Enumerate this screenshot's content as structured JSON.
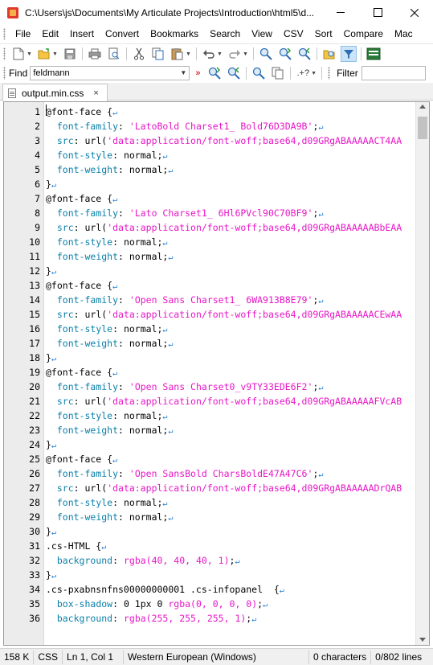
{
  "window": {
    "title": "C:\\Users\\js\\Documents\\My Articulate Projects\\Introduction\\html5\\d..."
  },
  "menu": [
    "File",
    "Edit",
    "Insert",
    "Convert",
    "Bookmarks",
    "Search",
    "View",
    "CSV",
    "Sort",
    "Compare",
    "Mac"
  ],
  "findbar": {
    "label": "Find",
    "value": "feldmann",
    "regex_label": ".+?",
    "filter_label": "Filter",
    "filter_value": ""
  },
  "tab": {
    "label": "output.min.css",
    "close": "×"
  },
  "editor": {
    "lines": [
      {
        "n": "1",
        "parts": [
          [
            "n",
            "@font-face {"
          ]
        ]
      },
      {
        "n": "2",
        "parts": [
          [
            "n",
            "  "
          ],
          [
            "k",
            "font-family"
          ],
          [
            "n",
            ": "
          ],
          [
            "s",
            "'LatoBold Charset1_ Bold76D3DA9B'"
          ],
          [
            "n",
            ";"
          ]
        ]
      },
      {
        "n": "3",
        "parts": [
          [
            "n",
            "  "
          ],
          [
            "k",
            "src"
          ],
          [
            "n",
            ": url("
          ],
          [
            "s",
            "'data:application/font-woff;base64,d09GRgABAAAAACT4AA"
          ]
        ]
      },
      {
        "n": "4",
        "parts": [
          [
            "n",
            "  "
          ],
          [
            "k",
            "font-style"
          ],
          [
            "n",
            ": normal;"
          ]
        ]
      },
      {
        "n": "5",
        "parts": [
          [
            "n",
            "  "
          ],
          [
            "k",
            "font-weight"
          ],
          [
            "n",
            ": normal;"
          ]
        ]
      },
      {
        "n": "6",
        "parts": [
          [
            "n",
            "}"
          ]
        ]
      },
      {
        "n": "7",
        "parts": [
          [
            "n",
            "@font-face {"
          ]
        ]
      },
      {
        "n": "8",
        "parts": [
          [
            "n",
            "  "
          ],
          [
            "k",
            "font-family"
          ],
          [
            "n",
            ": "
          ],
          [
            "s",
            "'Lato Charset1_ 6Hl6PVcl90C70BF9'"
          ],
          [
            "n",
            ";"
          ]
        ]
      },
      {
        "n": "9",
        "parts": [
          [
            "n",
            "  "
          ],
          [
            "k",
            "src"
          ],
          [
            "n",
            ": url("
          ],
          [
            "s",
            "'data:application/font-woff;base64,d09GRgABAAAAABbEAA"
          ]
        ]
      },
      {
        "n": "10",
        "parts": [
          [
            "n",
            "  "
          ],
          [
            "k",
            "font-style"
          ],
          [
            "n",
            ": normal;"
          ]
        ]
      },
      {
        "n": "11",
        "parts": [
          [
            "n",
            "  "
          ],
          [
            "k",
            "font-weight"
          ],
          [
            "n",
            ": normal;"
          ]
        ]
      },
      {
        "n": "12",
        "parts": [
          [
            "n",
            "}"
          ]
        ]
      },
      {
        "n": "13",
        "parts": [
          [
            "n",
            "@font-face {"
          ]
        ]
      },
      {
        "n": "14",
        "parts": [
          [
            "n",
            "  "
          ],
          [
            "k",
            "font-family"
          ],
          [
            "n",
            ": "
          ],
          [
            "s",
            "'Open Sans Charset1_ 6WA913B8E79'"
          ],
          [
            "n",
            ";"
          ]
        ]
      },
      {
        "n": "15",
        "parts": [
          [
            "n",
            "  "
          ],
          [
            "k",
            "src"
          ],
          [
            "n",
            ": url("
          ],
          [
            "s",
            "'data:application/font-woff;base64,d09GRgABAAAAACEwAA"
          ]
        ]
      },
      {
        "n": "16",
        "parts": [
          [
            "n",
            "  "
          ],
          [
            "k",
            "font-style"
          ],
          [
            "n",
            ": normal;"
          ]
        ]
      },
      {
        "n": "17",
        "parts": [
          [
            "n",
            "  "
          ],
          [
            "k",
            "font-weight"
          ],
          [
            "n",
            ": normal;"
          ]
        ]
      },
      {
        "n": "18",
        "parts": [
          [
            "n",
            "}"
          ]
        ]
      },
      {
        "n": "19",
        "parts": [
          [
            "n",
            "@font-face {"
          ]
        ]
      },
      {
        "n": "20",
        "parts": [
          [
            "n",
            "  "
          ],
          [
            "k",
            "font-family"
          ],
          [
            "n",
            ": "
          ],
          [
            "s",
            "'Open Sans Charset0_v9TY33EDE6F2'"
          ],
          [
            "n",
            ";"
          ]
        ]
      },
      {
        "n": "21",
        "parts": [
          [
            "n",
            "  "
          ],
          [
            "k",
            "src"
          ],
          [
            "n",
            ": url("
          ],
          [
            "s",
            "'data:application/font-woff;base64,d09GRgABAAAAAFVcAB"
          ]
        ]
      },
      {
        "n": "22",
        "parts": [
          [
            "n",
            "  "
          ],
          [
            "k",
            "font-style"
          ],
          [
            "n",
            ": normal;"
          ]
        ]
      },
      {
        "n": "23",
        "parts": [
          [
            "n",
            "  "
          ],
          [
            "k",
            "font-weight"
          ],
          [
            "n",
            ": normal;"
          ]
        ]
      },
      {
        "n": "24",
        "parts": [
          [
            "n",
            "}"
          ]
        ]
      },
      {
        "n": "25",
        "parts": [
          [
            "n",
            "@font-face {"
          ]
        ]
      },
      {
        "n": "26",
        "parts": [
          [
            "n",
            "  "
          ],
          [
            "k",
            "font-family"
          ],
          [
            "n",
            ": "
          ],
          [
            "s",
            "'Open SansBold CharsBoldE47A47C6'"
          ],
          [
            "n",
            ";"
          ]
        ]
      },
      {
        "n": "27",
        "parts": [
          [
            "n",
            "  "
          ],
          [
            "k",
            "src"
          ],
          [
            "n",
            ": url("
          ],
          [
            "s",
            "'data:application/font-woff;base64,d09GRgABAAAAADrQAB"
          ]
        ]
      },
      {
        "n": "28",
        "parts": [
          [
            "n",
            "  "
          ],
          [
            "k",
            "font-style"
          ],
          [
            "n",
            ": normal;"
          ]
        ]
      },
      {
        "n": "29",
        "parts": [
          [
            "n",
            "  "
          ],
          [
            "k",
            "font-weight"
          ],
          [
            "n",
            ": normal;"
          ]
        ]
      },
      {
        "n": "30",
        "parts": [
          [
            "n",
            "}"
          ]
        ]
      },
      {
        "n": "31",
        "parts": [
          [
            "n",
            ".cs-HTML {"
          ]
        ]
      },
      {
        "n": "32",
        "parts": [
          [
            "n",
            "  "
          ],
          [
            "k",
            "background"
          ],
          [
            "n",
            ": "
          ],
          [
            "s",
            "rgba(40, 40, 40, 1)"
          ],
          [
            "n",
            ";"
          ]
        ]
      },
      {
        "n": "33",
        "parts": [
          [
            "n",
            "}"
          ]
        ]
      },
      {
        "n": "34",
        "parts": [
          [
            "n",
            ".cs-pxabnsnfns00000000001 .cs-infopanel  {"
          ]
        ]
      },
      {
        "n": "35",
        "parts": [
          [
            "n",
            "  "
          ],
          [
            "k",
            "box-shadow"
          ],
          [
            "n",
            ": 0 1px 0 "
          ],
          [
            "s",
            "rgba(0, 0, 0, 0)"
          ],
          [
            "n",
            ";"
          ]
        ]
      },
      {
        "n": "36",
        "parts": [
          [
            "n",
            "  "
          ],
          [
            "k",
            "background"
          ],
          [
            "n",
            ": "
          ],
          [
            "s",
            "rgba(255, 255, 255, 1)"
          ],
          [
            "n",
            ";"
          ]
        ]
      }
    ],
    "eol_lines": [
      "1",
      "2",
      "4",
      "5",
      "6",
      "7",
      "8",
      "10",
      "11",
      "12",
      "13",
      "14",
      "16",
      "17",
      "18",
      "19",
      "20",
      "22",
      "23",
      "24",
      "25",
      "26",
      "28",
      "29",
      "30",
      "31",
      "32",
      "33",
      "34",
      "35",
      "36"
    ]
  },
  "status": {
    "size": "158 K",
    "syntax": "CSS",
    "position": "Ln 1, Col 1",
    "encoding": "Western European (Windows)",
    "selection": "0 characters",
    "lines": "0/802 lines"
  },
  "colors": {
    "keyword": "#0a7fa8",
    "string": "#e816c8",
    "eol_marker": "#1e7bd6",
    "find_arrow": "#d9343a"
  }
}
